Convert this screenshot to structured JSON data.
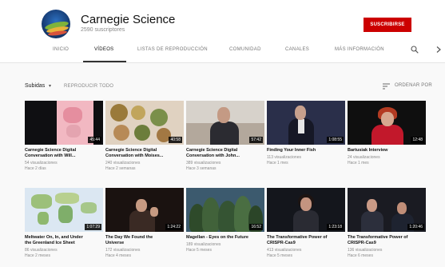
{
  "channel": {
    "name": "Carnegie Science",
    "subscribers": "2590 suscriptores",
    "subscribe_label": "SUSCRIBIRSE",
    "subscribe_color": "#cc0000"
  },
  "tabs": [
    {
      "label": "INICIO"
    },
    {
      "label": "VÍDEOS",
      "active": true
    },
    {
      "label": "LISTAS DE REPRODUCCIÓN"
    },
    {
      "label": "COMUNIDAD"
    },
    {
      "label": "CANALES"
    },
    {
      "label": "MÁS INFORMACIÓN"
    }
  ],
  "icons": {
    "search": "search-icon",
    "next": "chevron-right-icon",
    "sort": "sort-icon"
  },
  "toolbar": {
    "filter_label": "Subidas",
    "play_all_label": "REPRODUCIR TODO",
    "sort_label": "ORDENAR POR"
  },
  "videos": [
    {
      "title_1": "Carnegie Science Digital",
      "title_2": "Conversation with Will...",
      "views": "54 visualizaciones",
      "age": "Hace 2 días",
      "duration": "45:44"
    },
    {
      "title_1": "Carnegie Science Digital",
      "title_2": "Conversation with Moises...",
      "views": "240 visualizaciones",
      "age": "Hace 2 semanas",
      "duration": "40:58"
    },
    {
      "title_1": "Carnegie Science Digital",
      "title_2": "Conversation with John...",
      "views": "389 visualizaciones",
      "age": "Hace 3 semanas",
      "duration": "57:42"
    },
    {
      "title_1": "Finding Your Inner Fish",
      "title_2": "",
      "views": "113 visualizaciones",
      "age": "Hace 1 mes",
      "duration": "1:08:55"
    },
    {
      "title_1": "Bartusiak Interview",
      "title_2": "",
      "views": "24 visualizaciones",
      "age": "Hace 1 mes",
      "duration": "12:48"
    },
    {
      "title_1": "Meltwater On, In, and Under",
      "title_2": "the Greenland Ice Sheet",
      "views": "86 visualizaciones",
      "age": "Hace 2 meses",
      "duration": "1:07:29"
    },
    {
      "title_1": "The Day We Found the",
      "title_2": "Universe",
      "views": "172 visualizaciones",
      "age": "Hace 4 meses",
      "duration": "1:24:22"
    },
    {
      "title_1": "Magellan - Eyes on the Future",
      "title_2": "",
      "views": "189 visualizaciones",
      "age": "Hace 5 meses",
      "duration": "16:52"
    },
    {
      "title_1": "The Transformative Power of",
      "title_2": "CRISPR-Cas9",
      "views": "413 visualizaciones",
      "age": "Hace 5 meses",
      "duration": "1:23:18"
    },
    {
      "title_1": "The Transformative Power of",
      "title_2": "CRISPR-Cas9",
      "views": "136 visualizaciones",
      "age": "Hace 6 meses",
      "duration": "1:20:46"
    }
  ]
}
